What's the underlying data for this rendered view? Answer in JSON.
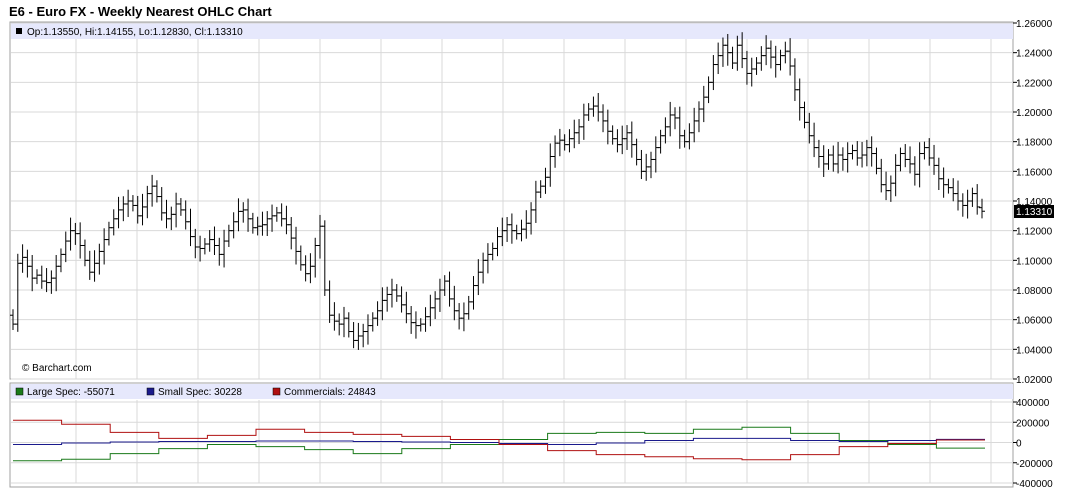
{
  "title": "E6 - Euro FX - Weekly Nearest OHLC Chart",
  "ohlc_readout": "Op:1.13550, Hi:1.14155, Lo:1.12830, Cl:1.13310",
  "watermark": "© Barchart.com",
  "last_price_label": "1.13310",
  "cot_legend": [
    {
      "label": "Large Spec: -55071",
      "color": "#1a7a1a"
    },
    {
      "label": "Small Spec: 30228",
      "color": "#1a1a8c"
    },
    {
      "label": "Commercials: 24843",
      "color": "#b01010"
    }
  ],
  "colors": {
    "header_band": "#e6e8fc",
    "grid": "#d9d9d9",
    "bars": "#000000",
    "large_spec": "#1a7a1a",
    "small_spec": "#1a1a8c",
    "commercials": "#b01010"
  },
  "chart_data": [
    {
      "type": "ohlc",
      "title": "E6 - Euro FX - Weekly Nearest OHLC Chart",
      "ylim": [
        1.02,
        1.26
      ],
      "y_ticks": [
        "1.26000",
        "1.24000",
        "1.22000",
        "1.20000",
        "1.18000",
        "1.16000",
        "1.14000",
        "1.12000",
        "1.10000",
        "1.08000",
        "1.06000",
        "1.04000",
        "1.02000"
      ],
      "grid": true,
      "close": [
        1.057,
        1.098,
        1.102,
        1.096,
        1.088,
        1.09,
        1.086,
        1.085,
        1.088,
        1.096,
        1.104,
        1.113,
        1.12,
        1.118,
        1.11,
        1.1,
        1.092,
        1.098,
        1.106,
        1.114,
        1.122,
        1.128,
        1.134,
        1.138,
        1.14,
        1.137,
        1.13,
        1.136,
        1.145,
        1.15,
        1.143,
        1.132,
        1.128,
        1.131,
        1.138,
        1.134,
        1.126,
        1.116,
        1.109,
        1.108,
        1.111,
        1.114,
        1.11,
        1.104,
        1.113,
        1.12,
        1.126,
        1.133,
        1.134,
        1.128,
        1.122,
        1.123,
        1.124,
        1.128,
        1.13,
        1.132,
        1.128,
        1.124,
        1.115,
        1.106,
        1.097,
        1.091,
        1.096,
        1.11,
        1.123,
        1.08,
        1.063,
        1.059,
        1.057,
        1.061,
        1.052,
        1.046,
        1.049,
        1.052,
        1.056,
        1.061,
        1.066,
        1.073,
        1.077,
        1.08,
        1.076,
        1.07,
        1.064,
        1.058,
        1.056,
        1.057,
        1.062,
        1.068,
        1.074,
        1.08,
        1.086,
        1.074,
        1.066,
        1.061,
        1.064,
        1.072,
        1.083,
        1.092,
        1.1,
        1.104,
        1.108,
        1.116,
        1.12,
        1.124,
        1.12,
        1.118,
        1.121,
        1.125,
        1.134,
        1.146,
        1.15,
        1.156,
        1.17,
        1.179,
        1.181,
        1.178,
        1.182,
        1.186,
        1.19,
        1.198,
        1.202,
        1.204,
        1.2,
        1.194,
        1.187,
        1.182,
        1.178,
        1.182,
        1.186,
        1.178,
        1.168,
        1.16,
        1.163,
        1.168,
        1.176,
        1.184,
        1.19,
        1.198,
        1.196,
        1.184,
        1.18,
        1.186,
        1.194,
        1.202,
        1.21,
        1.22,
        1.232,
        1.238,
        1.245,
        1.24,
        1.233,
        1.245,
        1.236,
        1.226,
        1.229,
        1.233,
        1.238,
        1.243,
        1.237,
        1.232,
        1.238,
        1.241,
        1.231,
        1.215,
        1.203,
        1.193,
        1.184,
        1.176,
        1.17,
        1.165,
        1.171,
        1.165,
        1.171,
        1.168,
        1.172,
        1.174,
        1.169,
        1.171,
        1.176,
        1.172,
        1.162,
        1.151,
        1.147,
        1.152,
        1.164,
        1.172,
        1.168,
        1.165,
        1.158,
        1.172,
        1.176,
        1.169,
        1.164,
        1.155,
        1.151,
        1.149,
        1.145,
        1.14,
        1.137,
        1.14,
        1.145,
        1.136,
        1.1331
      ],
      "ohlc_readout": {
        "open": 1.1355,
        "high": 1.14155,
        "low": 1.1283,
        "close": 1.1331
      }
    },
    {
      "type": "line",
      "title": "",
      "ylim": [
        -400000,
        400000
      ],
      "y_ticks": [
        "400000",
        "200000",
        "0",
        "-200000",
        "-400000"
      ],
      "grid": true,
      "x_points": 20,
      "series": [
        {
          "name": "Large Spec: -55071",
          "color": "#1a7a1a",
          "values": [
            -180000,
            -165000,
            -110000,
            -60000,
            -20000,
            -40000,
            -70000,
            -110000,
            -60000,
            -20000,
            30000,
            90000,
            100000,
            90000,
            130000,
            150000,
            90000,
            20000,
            -20000,
            -55071
          ]
        },
        {
          "name": "Small Spec: 30228",
          "color": "#1a1a8c",
          "values": [
            -20000,
            -5000,
            5000,
            10000,
            10000,
            15000,
            15000,
            10000,
            5000,
            0,
            -10000,
            -20000,
            -5000,
            20000,
            40000,
            40000,
            20000,
            10000,
            20000,
            30228
          ]
        },
        {
          "name": "Commercials: 24843",
          "color": "#b01010",
          "values": [
            220000,
            180000,
            100000,
            40000,
            70000,
            130000,
            100000,
            80000,
            60000,
            30000,
            -20000,
            -80000,
            -120000,
            -140000,
            -160000,
            -170000,
            -120000,
            -40000,
            -10000,
            24843
          ]
        }
      ]
    }
  ]
}
